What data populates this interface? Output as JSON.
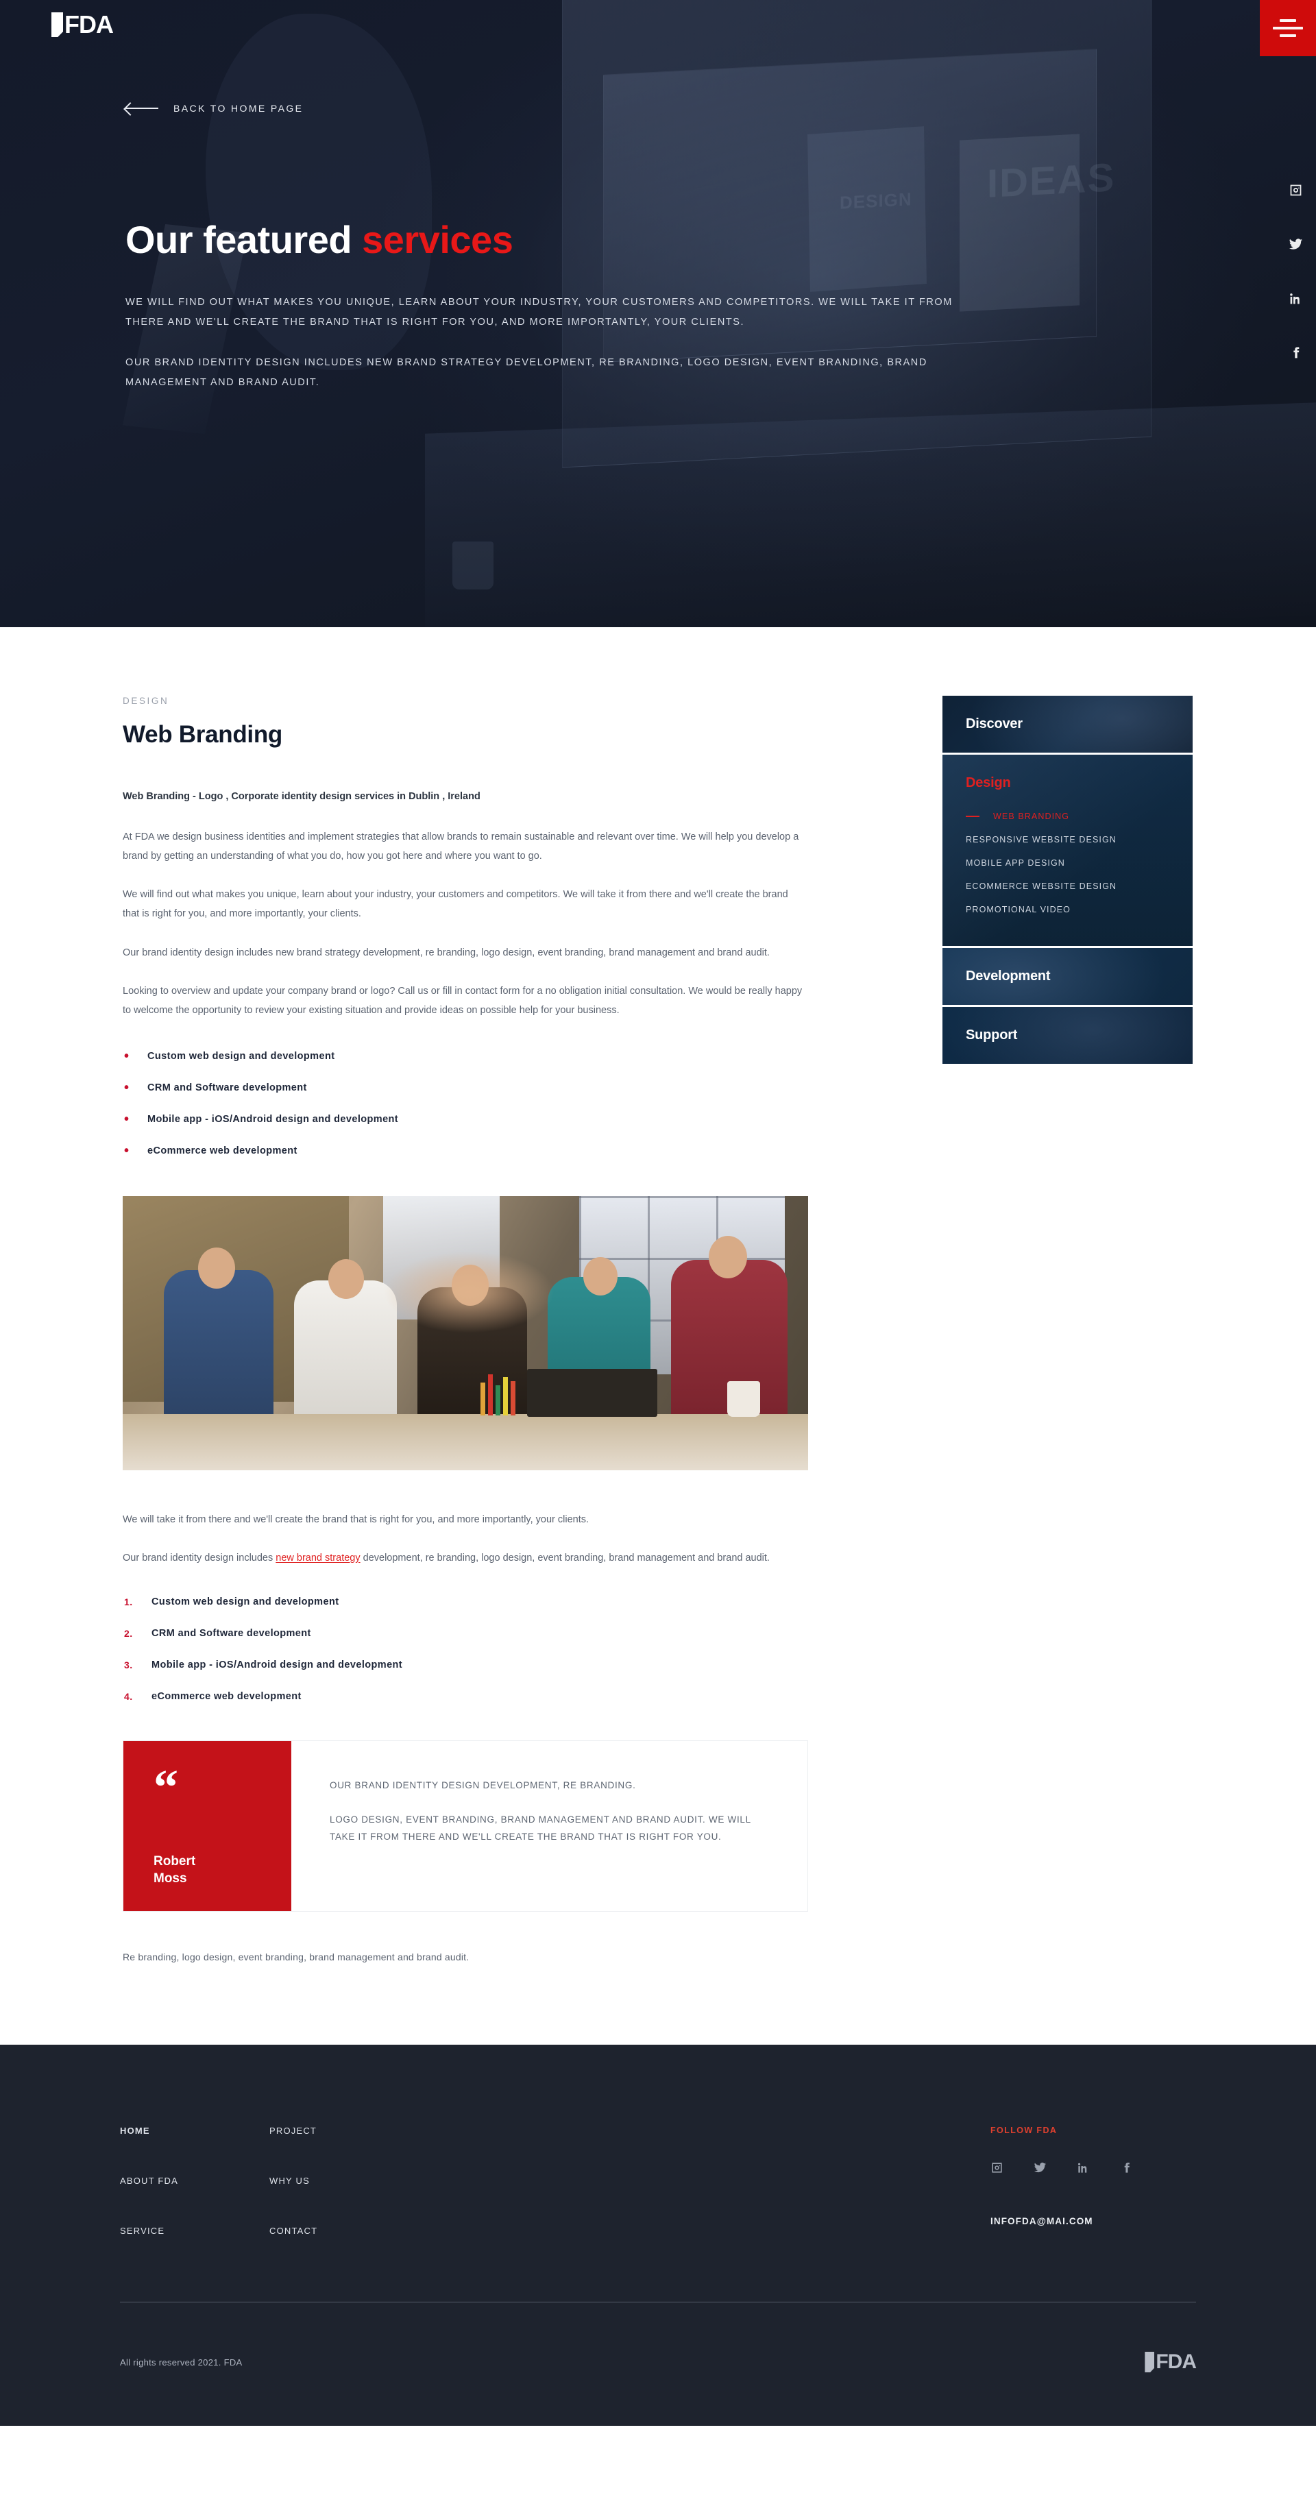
{
  "brand": {
    "name": "FDA",
    "accent_color": "#e81818",
    "dark_color": "#1e232e"
  },
  "header": {
    "logo_text": "FDA",
    "menu_icon": "hamburger-icon"
  },
  "hero": {
    "back_label": "BACK TO HOME PAGE",
    "title_plain": "Our featured ",
    "title_accent": "services",
    "paragraph_1": "WE WILL FIND OUT WHAT MAKES YOU UNIQUE, LEARN ABOUT YOUR INDUSTRY, YOUR CUSTOMERS AND COMPETITORS. WE WILL TAKE IT FROM THERE AND WE'LL CREATE THE BRAND THAT IS RIGHT FOR YOU, AND MORE IMPORTANTLY, YOUR CLIENTS.",
    "paragraph_2": "OUR BRAND IDENTITY DESIGN INCLUDES NEW BRAND STRATEGY DEVELOPMENT, RE BRANDING, LOGO DESIGN, EVENT BRANDING, BRAND MANAGEMENT AND BRAND AUDIT.",
    "social_rail": [
      {
        "icon": "instagram-icon"
      },
      {
        "icon": "twitter-icon"
      },
      {
        "icon": "linkedin-icon"
      },
      {
        "icon": "facebook-icon"
      }
    ]
  },
  "article": {
    "eyebrow": "DESIGN",
    "title": "Web Branding",
    "lead": "Web Branding - Logo , Corporate identity design services in Dublin , Ireland",
    "paragraphs": [
      "At FDA we design business identities and implement strategies that allow brands to remain sustainable and relevant over time. We will help you develop a brand by getting an understanding of what you do, how you got here and where you want to go.",
      "We will find out what makes you unique, learn about your industry, your customers and competitors. We will take it from there and we'll create the brand that is right for you, and more importantly, your clients.",
      "Our brand identity design includes new brand strategy development, re branding, logo design, event branding, brand management and brand audit.",
      "Looking to overview and update your company brand or logo? Call us or fill in contact form for a no obligation initial consultation. We would be really happy to welcome the opportunity to review your existing situation and provide ideas on possible help for your business."
    ],
    "bullets": [
      "Custom web design and development",
      "CRM and Software development",
      "Mobile app - iOS/Android design and development",
      "eCommerce web development"
    ],
    "image_alt": "team-high-five-photo",
    "after_image_paragraph": "We will take it from there and we'll create the brand that is right for you, and more importantly, your clients.",
    "linked_paragraph_before": "Our brand identity design includes ",
    "linked_paragraph_link": "new brand strategy",
    "linked_paragraph_after": " development, re branding, logo design, event branding, brand management and brand audit.",
    "numbers": [
      "Custom web design and development",
      "CRM and Software development",
      "Mobile app - iOS/Android design and development",
      "eCommerce web development"
    ],
    "quote": {
      "author_line_1": "Robert",
      "author_line_2": "Moss",
      "lines": [
        "OUR BRAND IDENTITY DESIGN DEVELOPMENT, RE BRANDING.",
        "LOGO DESIGN, EVENT BRANDING, BRAND MANAGEMENT AND BRAND AUDIT. WE WILL TAKE IT FROM THERE AND WE'LL CREATE THE BRAND THAT IS RIGHT FOR YOU."
      ]
    },
    "tail_paragraph": "Re branding, logo design, event branding, brand management and brand audit."
  },
  "sidebar": {
    "items": [
      {
        "label": "Discover",
        "active": false
      },
      {
        "label": "Design",
        "active": true
      },
      {
        "label": "Development",
        "active": false
      },
      {
        "label": "Support",
        "active": false
      }
    ],
    "design_subitems": [
      {
        "label": "WEB BRANDING",
        "active": true
      },
      {
        "label": "RESPONSIVE WEBSITE DESIGN",
        "active": false
      },
      {
        "label": "MOBILE APP DESIGN",
        "active": false
      },
      {
        "label": "ECOMMERCE WEBSITE DESIGN",
        "active": false
      },
      {
        "label": "PROMOTIONAL VIDEO",
        "active": false
      }
    ]
  },
  "footer": {
    "col1": [
      {
        "label": "HOME",
        "bold": true
      },
      {
        "label": "ABOUT FDA",
        "bold": false
      },
      {
        "label": "SERVICE",
        "bold": false
      }
    ],
    "col2": [
      {
        "label": "PROJECT",
        "bold": false
      },
      {
        "label": "WHY US",
        "bold": false
      },
      {
        "label": "CONTACT",
        "bold": false
      }
    ],
    "follow_title": "FOLLOW FDA",
    "socials": [
      {
        "icon": "instagram-icon"
      },
      {
        "icon": "twitter-icon"
      },
      {
        "icon": "linkedin-icon"
      },
      {
        "icon": "facebook-icon"
      }
    ],
    "email": "INFOFDA@MAI.COM",
    "copyright": "All rights reserved 2021. FDA",
    "logo_text": "FDA"
  }
}
